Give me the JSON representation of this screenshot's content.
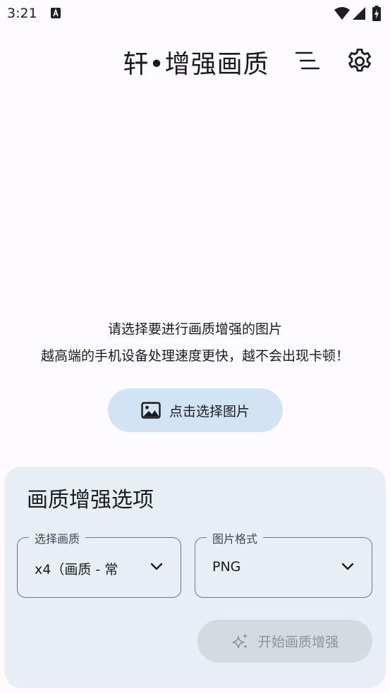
{
  "status_bar": {
    "time": "3:21",
    "icons": [
      "a-notification-icon",
      "wifi-icon",
      "signal-icon",
      "battery-charging-icon"
    ]
  },
  "top_bar": {
    "title": "轩•增强画质",
    "icons": [
      "menu-icon",
      "gear-icon"
    ]
  },
  "prompt": {
    "line1": "请选择要进行画质增强的图片",
    "line2": "越高端的手机设备处理速度更快，越不会出现卡顿！"
  },
  "pick_image_button": {
    "icon": "image-icon",
    "label": "点击选择图片"
  },
  "options": {
    "title": "画质增强选项",
    "quality_field": {
      "label": "选择画质",
      "value": "x4（画质 - 常"
    },
    "format_field": {
      "label": "图片格式",
      "value": "PNG"
    },
    "start_button": {
      "icon": "sparkle-icon",
      "label": "开始画质增强"
    }
  },
  "colors": {
    "background": "#fdfbff",
    "pick_button_bg": "#d2e4f4",
    "card_bg": "#e7eef6",
    "start_button_bg_disabled": "#d5dae1",
    "start_button_text_disabled": "#8e9299"
  }
}
